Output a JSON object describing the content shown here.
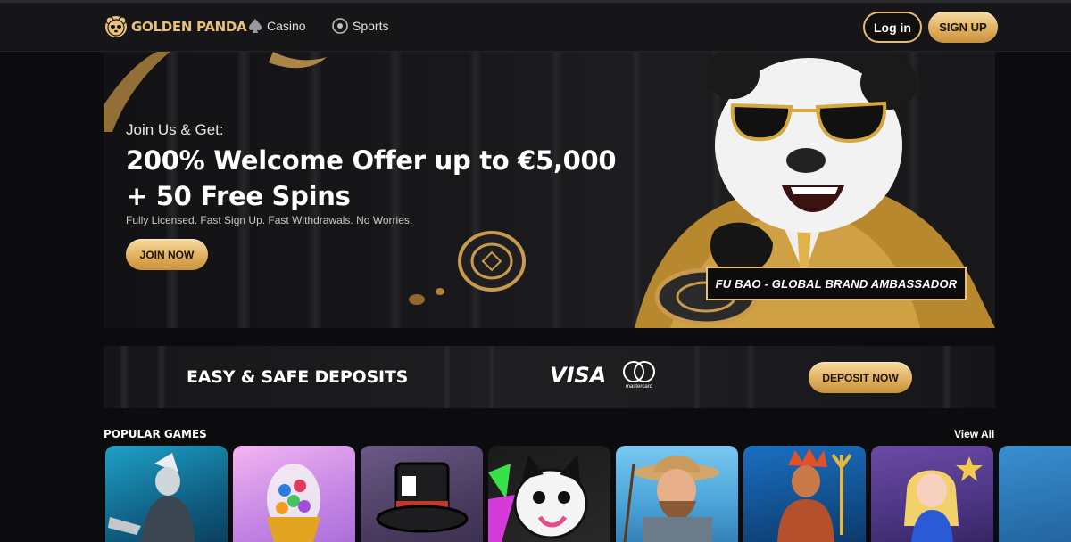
{
  "header": {
    "brand": "GOLDEN PANDA",
    "nav": [
      {
        "label": "Casino",
        "icon": "spade-icon"
      },
      {
        "label": "Sports",
        "icon": "soccer-ball-icon"
      }
    ],
    "login_label": "Log in",
    "signup_label": "SIGN UP"
  },
  "hero": {
    "kicker": "Join Us & Get:",
    "headline_line1": "200% Welcome Offer up to €5,000",
    "headline_line2": "+ 50 Free Spins",
    "subtext": "Fully Licensed. Fast Sign Up. Fast Withdrawals. No Worries.",
    "cta_label": "JOIN NOW",
    "ambassador_caption": "FU BAO - GLOBAL BRAND AMBASSADOR"
  },
  "deposits": {
    "title": "EASY & SAFE DEPOSITS",
    "visa_label": "VISA",
    "mastercard_label": "mastercard",
    "cta_label": "DEPOSIT NOW"
  },
  "popular_games": {
    "title": "POPULAR GAMES",
    "view_all_label": "View All"
  },
  "colors": {
    "accent_gold": "#e3bb77",
    "background": "#0c0c0e",
    "header_bg": "#161618"
  }
}
